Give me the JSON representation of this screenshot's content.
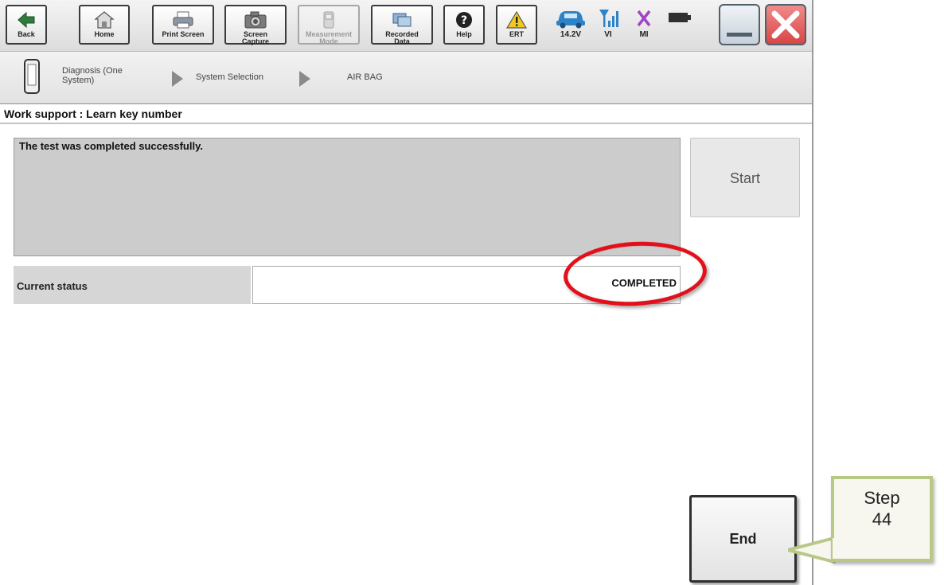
{
  "toolbar": {
    "buttons": [
      {
        "label": "Back",
        "icon": "back-arrow-icon"
      },
      {
        "label": "Home",
        "icon": "home-icon"
      },
      {
        "label": "Print Screen",
        "icon": "printer-icon"
      },
      {
        "label": "Screen\nCapture",
        "icon": "camera-icon"
      },
      {
        "label": "Measurement\nMode",
        "icon": "measurement-icon",
        "disabled": true
      },
      {
        "label": "Recorded\nData",
        "icon": "recorded-data-icon"
      },
      {
        "label": "Help",
        "icon": "help-icon"
      },
      {
        "label": "ERT",
        "icon": "warning-icon"
      }
    ],
    "status": [
      {
        "label": "14.2V",
        "icon": "car-battery-icon"
      },
      {
        "label": "VI",
        "icon": "signal-icon"
      },
      {
        "label": "MI",
        "icon": "x-mark-icon"
      }
    ]
  },
  "breadcrumb": {
    "items": [
      "Diagnosis (One\nSystem)",
      "System Selection",
      "AIR BAG"
    ]
  },
  "page": {
    "title": "Work support : Learn key number"
  },
  "work": {
    "message": "The test was completed successfully.",
    "start_label": "Start",
    "status_label": "Current status",
    "status_value": "COMPLETED",
    "end_label": "End"
  },
  "callout": {
    "line1": "Step",
    "line2": "44"
  },
  "colors": {
    "highlight": "#e30f1a",
    "callout_border": "#b8c887",
    "close_button": "#e05a5a"
  }
}
